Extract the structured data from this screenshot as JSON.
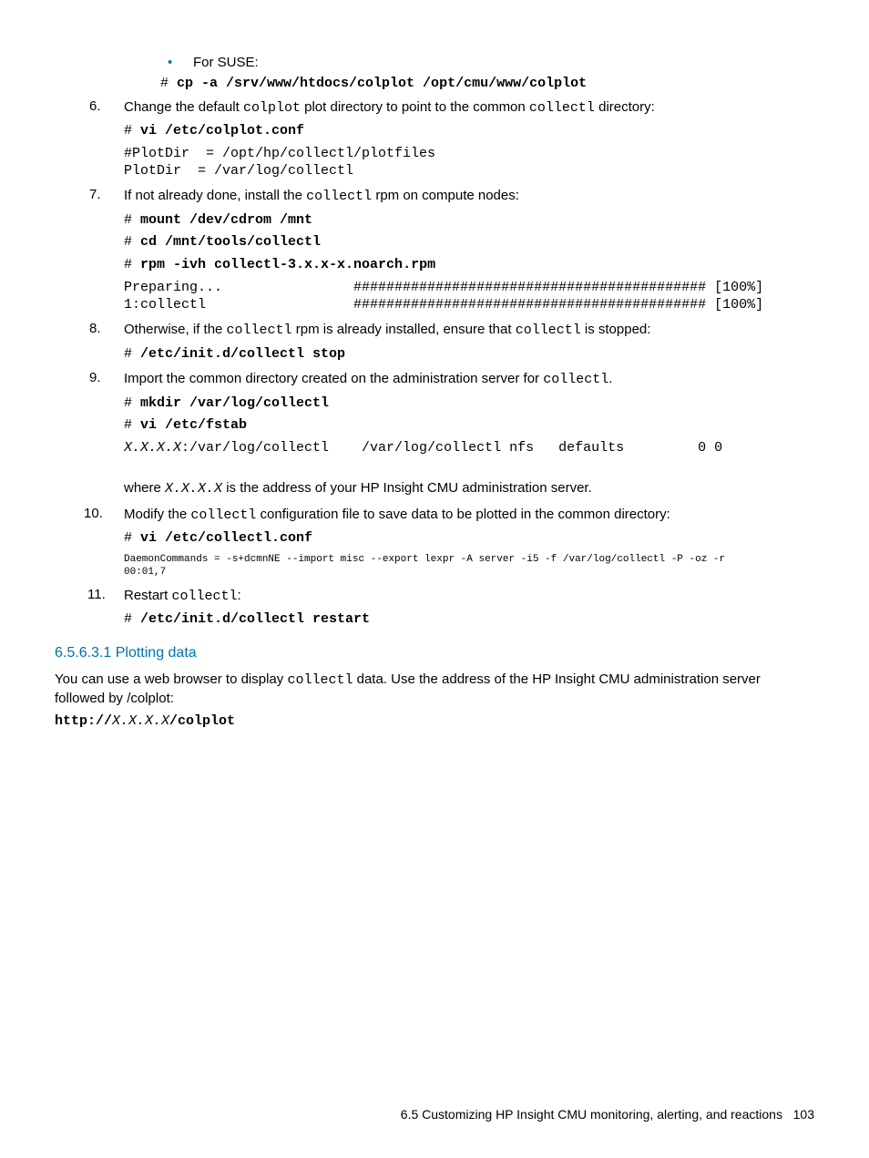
{
  "bullets": {
    "suse_label": "For SUSE:",
    "suse_cmd_prefix": "# ",
    "suse_cmd": "cp -a /srv/www/htdocs/colplot /opt/cmu/www/colplot"
  },
  "step6": {
    "num": "6.",
    "text_a": "Change the default ",
    "code_a": "colplot",
    "text_b": " plot directory to point to the common ",
    "code_b": "collectl",
    "text_c": " directory:",
    "cmd_prefix": "# ",
    "cmd": "vi /etc/colplot.conf",
    "out1": "#PlotDir  = /opt/hp/collectl/plotfiles",
    "out2": "PlotDir  = /var/log/collectl"
  },
  "step7": {
    "num": "7.",
    "text_a": "If not already done, install the ",
    "code_a": "collectl",
    "text_b": " rpm on compute nodes:",
    "cmd1_prefix": "# ",
    "cmd1": "mount /dev/cdrom /mnt",
    "cmd2_prefix": "# ",
    "cmd2": "cd /mnt/tools/collectl",
    "cmd3_prefix": "# ",
    "cmd3": "rpm -ivh collectl-3.x.x-x.noarch.rpm",
    "out1": "Preparing...                ########################################### [100%]",
    "out2": "1:collectl                  ########################################### [100%]"
  },
  "step8": {
    "num": "8.",
    "text_a": "Otherwise, if the ",
    "code_a": "collectl",
    "text_b": " rpm is already installed, ensure that ",
    "code_b": "collectl",
    "text_c": " is stopped:",
    "cmd_prefix": "# ",
    "cmd": "/etc/init.d/collectl stop"
  },
  "step9": {
    "num": "9.",
    "text_a": "Import the common directory created on the administration server for ",
    "code_a": "collectl",
    "text_b": ".",
    "cmd1_prefix": "# ",
    "cmd1": "mkdir /var/log/collectl",
    "cmd2_prefix": "# ",
    "cmd2": "vi /etc/fstab",
    "out_ip": "X.X.X.X",
    "out_rest": ":/var/log/collectl    /var/log/collectl nfs   defaults         0 0",
    "where_a": "where ",
    "where_ip": "X.X.X.X",
    "where_b": " is the address of your HP Insight CMU administration server."
  },
  "step10": {
    "num": "10.",
    "text_a": "Modify the ",
    "code_a": "collectl",
    "text_b": " configuration file to save data to be plotted in the common directory:",
    "cmd_prefix": "# ",
    "cmd": "vi /etc/collectl.conf",
    "out": "DaemonCommands = -s+dcmnNE --import misc --export lexpr -A server -i5 -f /var/log/collectl -P -oz -r\n00:01,7"
  },
  "step11": {
    "num": "11.",
    "text_a": "Restart ",
    "code_a": "collectl",
    "text_b": ":",
    "cmd_prefix": "# ",
    "cmd": "/etc/init.d/collectl restart"
  },
  "section": {
    "num_title": "6.5.6.3.1 Plotting data",
    "para_a": "You can use a web browser to display ",
    "para_code": "collectl",
    "para_b": " data. Use the address of the HP Insight CMU administration server followed by /colplot:",
    "url_a": "http://",
    "url_ip": "X.X.X.X",
    "url_b": "/colplot"
  },
  "footer": {
    "text": "6.5 Customizing HP Insight CMU monitoring, alerting, and reactions",
    "page": "103"
  }
}
